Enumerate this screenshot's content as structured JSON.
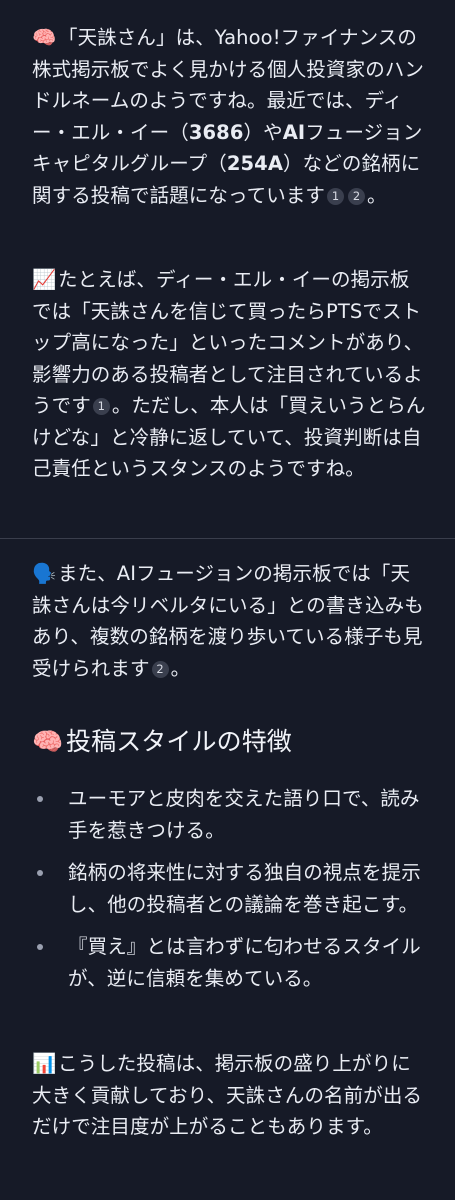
{
  "intro": {
    "emoji": "🧠",
    "parts": [
      "「天誅さん」は、Yahoo!ファイナンスの株式掲示板でよく見かける個人投資家のハンドルネームのようですね。最近では、ディー・エル・イー（",
      "3686",
      "）や",
      "AI",
      "フュージョンキャピタルグループ（",
      "254A",
      "）などの銘柄に関する投稿で話題になっています"
    ],
    "citations": [
      "1",
      "2"
    ],
    "end": "。"
  },
  "example": {
    "emoji": "📈",
    "text_before": "たとえば、ディー・エル・イーの掲示板では「天誅さんを信じて買ったらPTSでストップ高になった」といったコメントがあり、影響力のある投稿者として注目されているようです",
    "citation": "1",
    "text_after": "。ただし、本人は「買えいうとらんけどな」と冷静に返していて、投資判断は自己責任というスタンスのようですね。"
  },
  "ai_fusion": {
    "emoji": "🗣️",
    "text_before": "また、AIフュージョンの掲示板では「天誅さんは今リベルタにいる」との書き込みもあり、複数の銘柄を渡り歩いている様子も見受けられます",
    "citation": "2",
    "text_after": "。"
  },
  "style_section": {
    "emoji": "🧠",
    "heading": "投稿スタイルの特徴",
    "bullets": [
      "ユーモアと皮肉を交えた語り口で、読み手を惹きつける。",
      "銘柄の将来性に対する独自の視点を提示し、他の投稿者との議論を巻き起こす。",
      "『買え』とは言わずに匂わせるスタイルが、逆に信頼を集めている。"
    ]
  },
  "conclusion": {
    "emoji": "📊",
    "text": "こうした投稿は、掲示板の盛り上がりに大きく貢献しており、天誅さんの名前が出るだけで注目度が上がることもあります。"
  }
}
